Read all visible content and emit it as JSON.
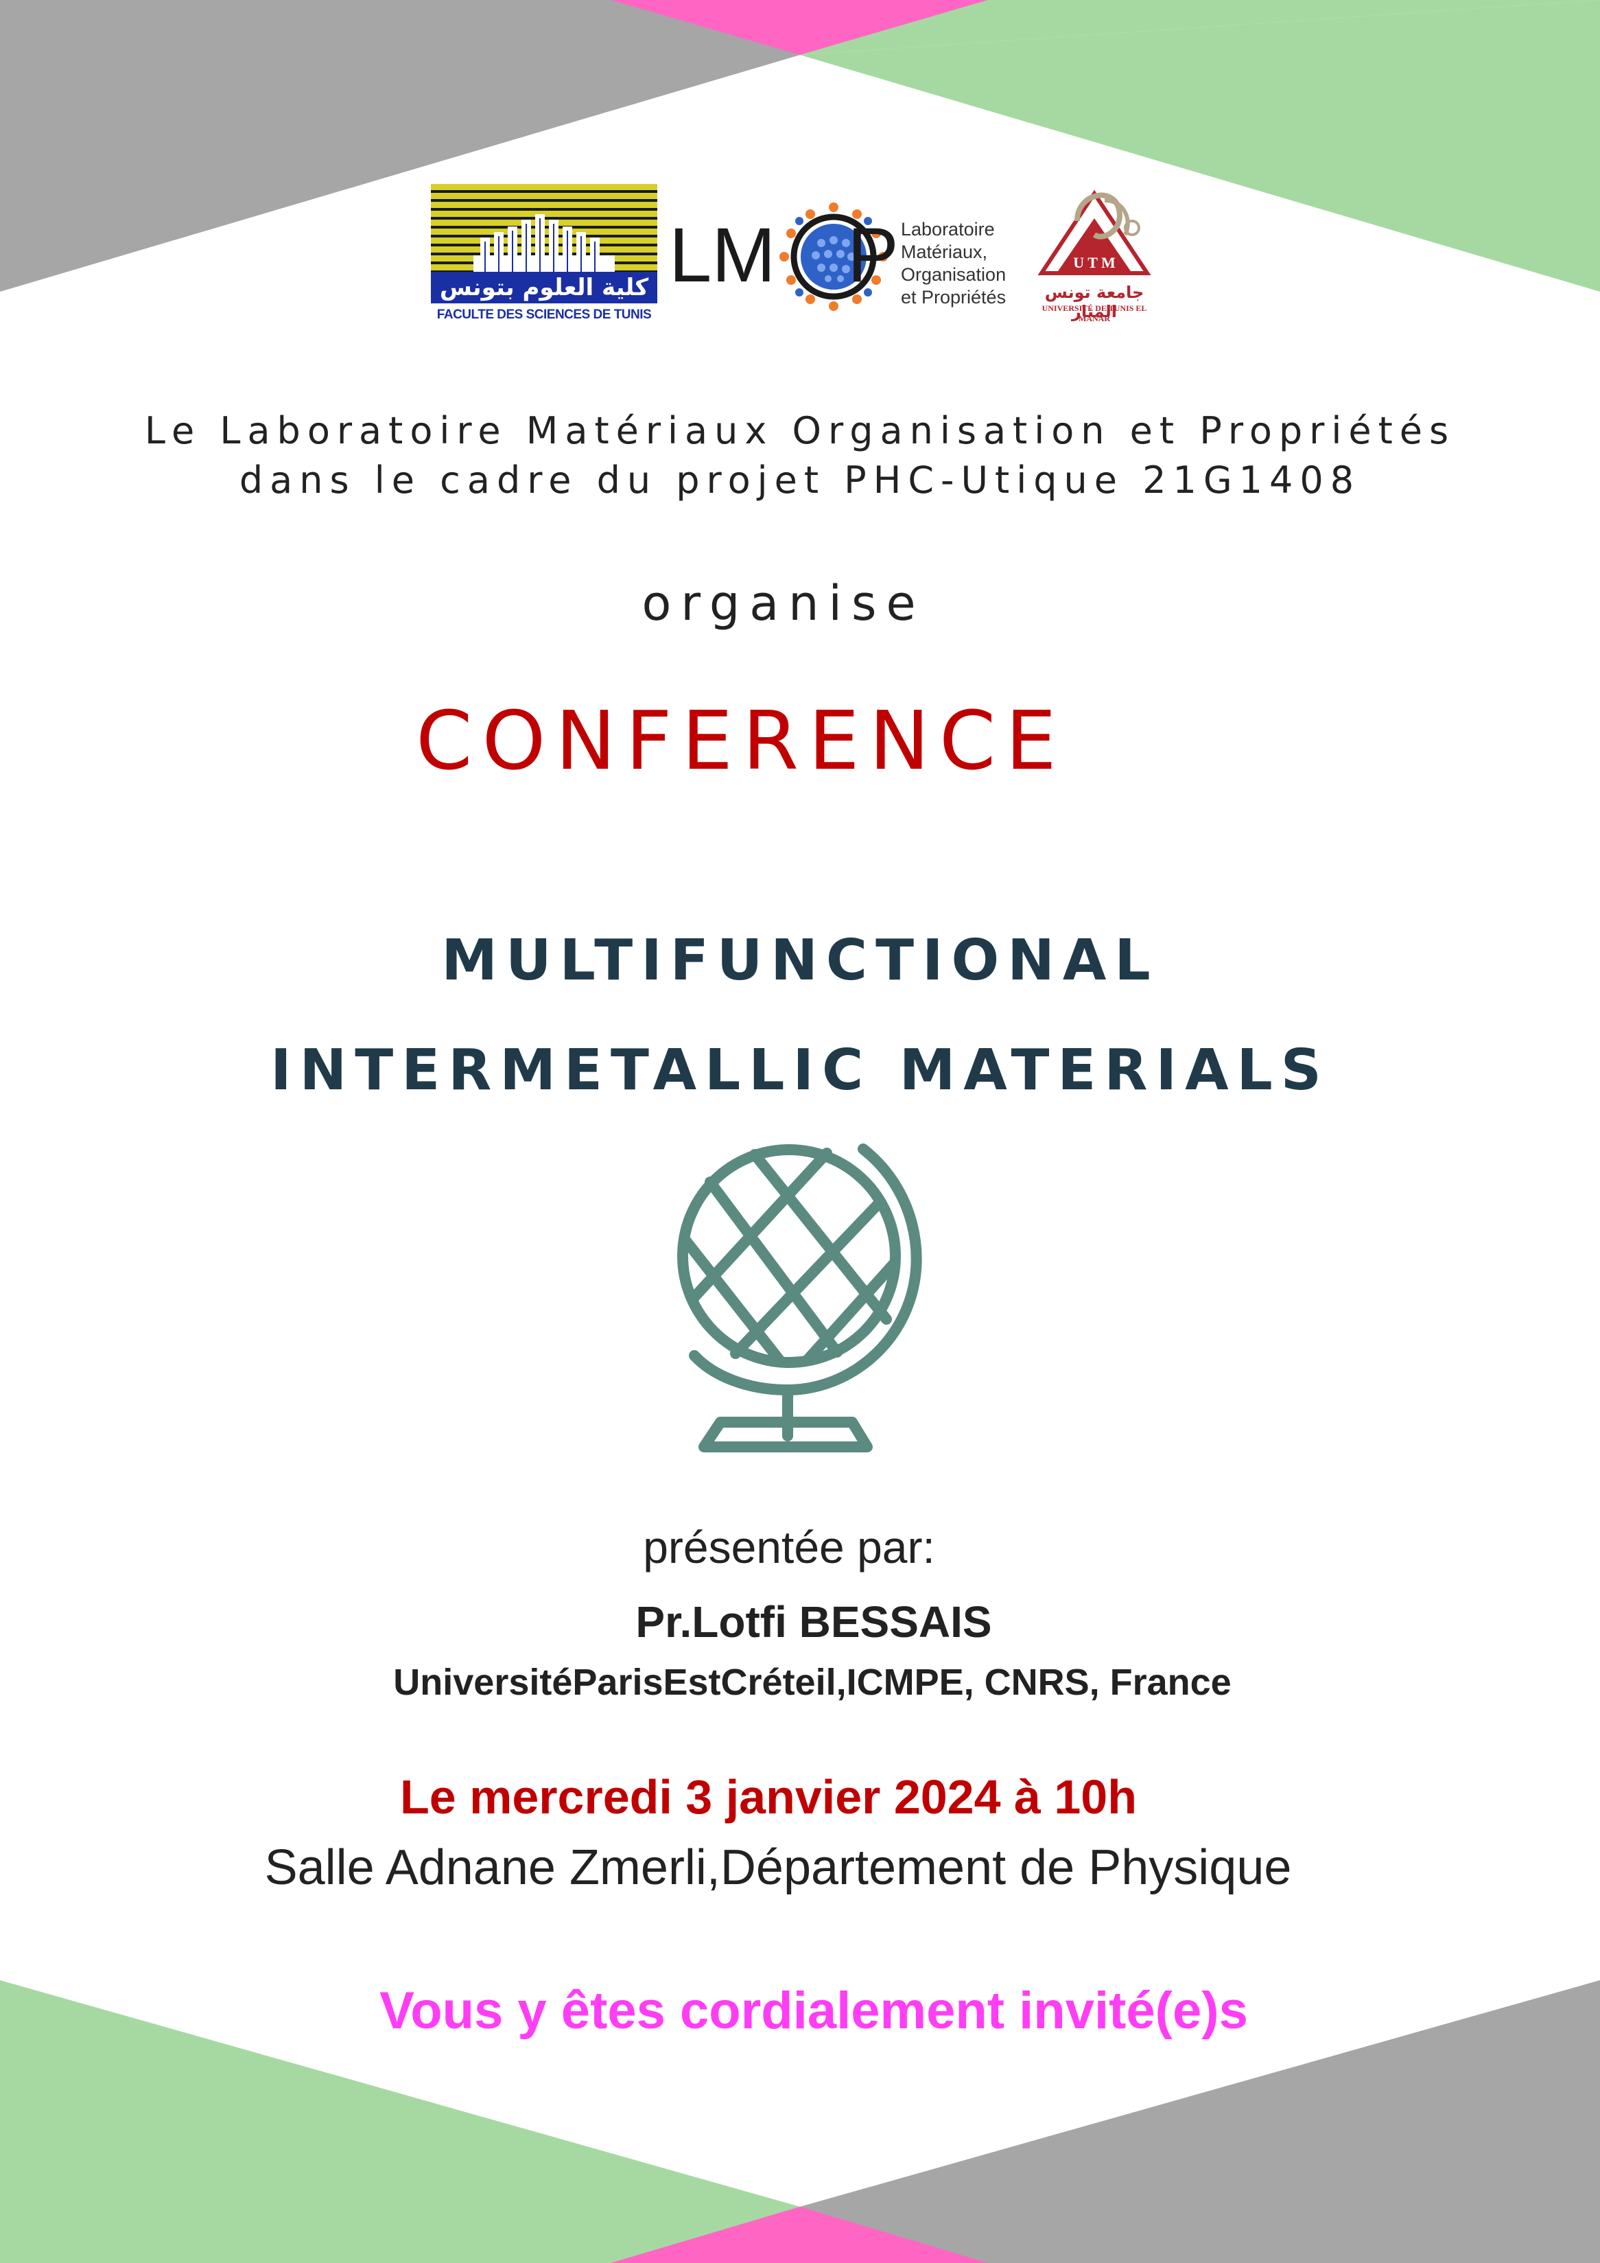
{
  "colors": {
    "gray": "#a6a6a6",
    "green": "#a6d9a1",
    "pink": "#ff66c4",
    "dark_red": "#c00000",
    "navy": "#203a4a",
    "globe": "#5b8a80",
    "magenta": "#ff3df5",
    "text": "#222222"
  },
  "logos": {
    "fst": {
      "arabic": "كلية العلوم بتونس",
      "caption": "FACULTE DES SCIENCES DE TUNIS"
    },
    "lmop": {
      "letters": "LM",
      "letter_p": "P",
      "text_lines": [
        "Laboratoire",
        "Matériaux,",
        "Organisation",
        "et Propriétés"
      ]
    },
    "utm": {
      "letters": "U T M",
      "arabic": "جامعة تونس المنار",
      "caption": "UNIVERSITÉ DE TUNIS EL MANAR"
    }
  },
  "header": {
    "line1": "Le Laboratoire Matériaux Organisation et Propriétés",
    "line2": "dans le cadre du projet PHC-Utique 21G1408"
  },
  "organise": "organise",
  "event_type": "CONFERENCE",
  "title": {
    "line1": "MULTIFUNCTIONAL",
    "line2": "INTERMETALLIC MATERIALS"
  },
  "icon": "globe-icon",
  "presenter": {
    "label": "présentée par:",
    "name": "Pr.Lotfi BESSAIS",
    "affiliation": "UniversitéParisEstCréteil,ICMPE, CNRS, France"
  },
  "date": "Le mercredi 3 janvier 2024 à 10h",
  "location": "Salle Adnane Zmerli,Département de Physique",
  "invitation": "Vous y êtes cordialement invité(e)s"
}
